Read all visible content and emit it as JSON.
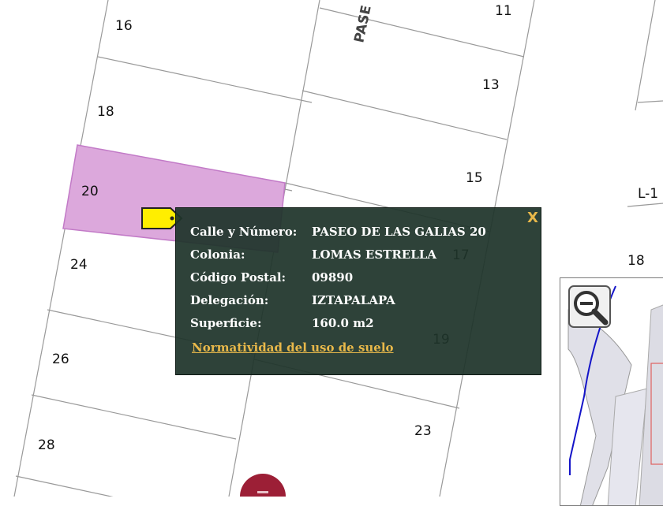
{
  "map": {
    "street_label": "PASE",
    "lots": [
      "16",
      "11",
      "13",
      "18",
      "15",
      "20",
      "24",
      "17",
      "19",
      "26",
      "23",
      "28",
      "L-1",
      "18"
    ],
    "selected_lot": "20",
    "colors": {
      "background": "#ffffff",
      "lot_line": "#999999",
      "selected_fill": "#dca8dc",
      "selected_stroke": "#c27ac7",
      "marker": "#ffee00",
      "popup_bg": "#1e342a",
      "accent": "#e8b84a"
    }
  },
  "popup": {
    "close_label": "X",
    "rows": [
      {
        "label": "Calle y Número:",
        "value": "PASEO DE LAS GALIAS 20"
      },
      {
        "label": "Colonia:",
        "value": "LOMAS ESTRELLA"
      },
      {
        "label": "Código Postal:",
        "value": "09890"
      },
      {
        "label": "Delegación:",
        "value": "IZTAPALAPA"
      },
      {
        "label": "Superficie:",
        "value": "160.0 m2"
      }
    ],
    "link_label": "Normatividad del uso de suelo"
  },
  "controls": {
    "zoom_out_icon": "magnifier-minus-icon"
  }
}
